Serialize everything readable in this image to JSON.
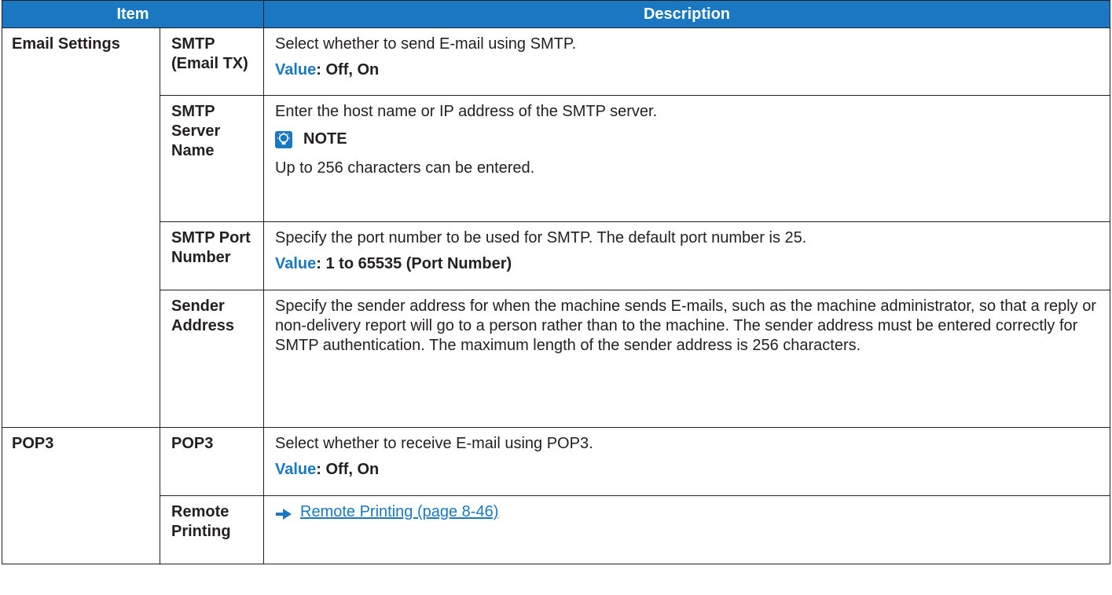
{
  "table": {
    "headers": {
      "item": "Item",
      "description": "Description"
    },
    "email_settings": {
      "group_label": "Email Settings",
      "rows": [
        {
          "item": "SMTP (Email TX)",
          "description": "Select whether to send E-mail using SMTP.",
          "value_key": "Value",
          "value_text": ": Off, On"
        },
        {
          "item": "SMTP Server Name",
          "description": "Enter the host name or IP address of the SMTP server.",
          "note_label": "NOTE",
          "note_icon": "note-lightbulb-icon",
          "note_text": "Up to 256 characters can be entered."
        },
        {
          "item": "SMTP Port Number",
          "description": "Specify the port number to be used for SMTP. The default port number is 25.",
          "value_key": "Value",
          "value_text": ": 1 to 65535 (Port Number)"
        },
        {
          "item": "Sender Address",
          "description": "Specify the sender address for when the machine sends E-mails, such as the machine administrator, so that a reply or non-delivery report will go to a person rather than to the machine. The sender address must be entered correctly for SMTP authentication. The maximum length of the sender address is 256 characters."
        }
      ]
    },
    "pop3": {
      "group_label": "POP3",
      "rows": [
        {
          "item": "POP3",
          "description": "Select whether to receive E-mail using POP3.",
          "value_key": "Value",
          "value_text": ": Off, On"
        },
        {
          "item": "Remote Printing",
          "link_icon": "arrow-right-icon",
          "link_text": "Remote Printing (page 8-46)"
        }
      ]
    }
  },
  "colors": {
    "header_bg": "#1a78c2",
    "accent": "#1a78c2",
    "text": "#231f20"
  }
}
